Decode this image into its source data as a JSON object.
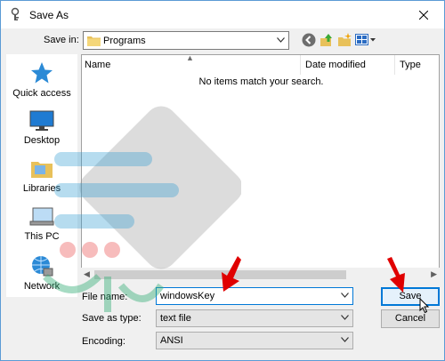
{
  "dialog": {
    "title": "Save As",
    "accent": "#0078d7"
  },
  "toolbar": {
    "save_in_label": "Save in:",
    "save_in_value": "Programs",
    "icons": [
      "back-icon",
      "up-folder-icon",
      "new-folder-icon",
      "view-menu-icon"
    ]
  },
  "places": [
    {
      "label": "Quick access",
      "icon": "star-icon"
    },
    {
      "label": "Desktop",
      "icon": "desktop-icon"
    },
    {
      "label": "Libraries",
      "icon": "libraries-icon"
    },
    {
      "label": "This PC",
      "icon": "computer-icon"
    },
    {
      "label": "Network",
      "icon": "network-icon"
    }
  ],
  "filelist": {
    "columns": [
      "Name",
      "Date modified",
      "Type"
    ],
    "empty_message": "No items match your search."
  },
  "form": {
    "file_name_label": "File name:",
    "file_name_value": "windowsKey",
    "save_as_type_label": "Save as type:",
    "save_as_type_value": "text file",
    "encoding_label": "Encoding:",
    "encoding_value": "ANSI"
  },
  "buttons": {
    "save": "Save",
    "cancel": "Cancel"
  }
}
